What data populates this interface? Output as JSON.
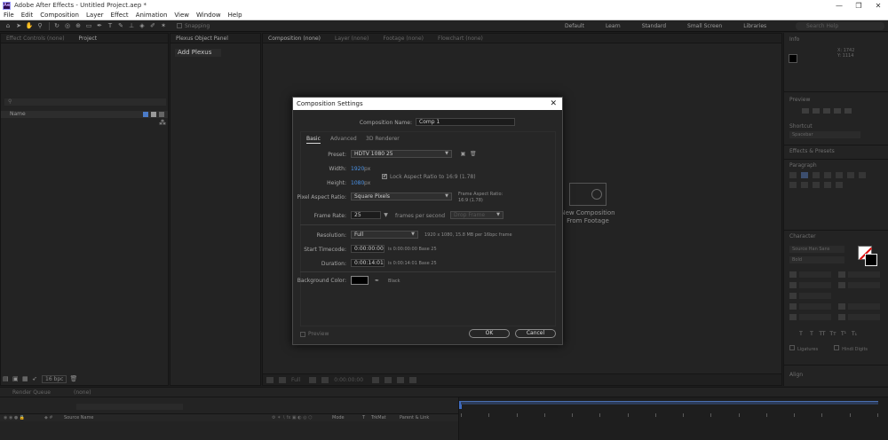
{
  "titlebar": {
    "logo": "Ae",
    "title": "Adobe After Effects - Untitled Project.aep *",
    "minimize": "—",
    "restore": "❐",
    "close": "✕"
  },
  "menu": [
    "File",
    "Edit",
    "Composition",
    "Layer",
    "Effect",
    "Animation",
    "View",
    "Window",
    "Help"
  ],
  "toolbar": {
    "snapping": "Snapping",
    "workspaces": [
      "Default",
      "Learn",
      "Standard",
      "Small Screen",
      "Libraries"
    ],
    "search_placeholder": "Search Help"
  },
  "project_panel": {
    "tabs": [
      "Effect Controls (none)",
      "Project"
    ],
    "column_name": "Name",
    "bpc": "16 bpc"
  },
  "plexus_panel": {
    "tab": "Plexus Object Panel",
    "add_button": "Add Plexus"
  },
  "comp_panel": {
    "tabs": [
      "Composition (none)",
      "Layer (none)",
      "Footage (none)",
      "Flowchart (none)"
    ],
    "placeholder_line1": "New Composition",
    "placeholder_line2": "From Footage",
    "timecode": "0:00:00:00",
    "zoom": "Full"
  },
  "right_panels": {
    "info": "Info",
    "info_xy": [
      "X: 1742",
      "Y: 1114"
    ],
    "preview": "Preview",
    "shortcut_label": "Shortcut",
    "shortcut_value": "Spacebar",
    "effects_presets": "Effects & Presets",
    "paragraph": "Paragraph",
    "character": "Character",
    "font": "Source Han Sans",
    "font_style": "Bold",
    "size": "100 px",
    "ligatures": "Ligatures",
    "hindi_digits": "Hindi Digits",
    "align": "Align"
  },
  "timeline": {
    "tabs": [
      "Render Queue",
      "(none)"
    ],
    "columns": [
      "Source Name",
      "Mode",
      "T",
      "TrkMat",
      "Parent & Link"
    ]
  },
  "dialog": {
    "title": "Composition Settings",
    "close": "✕",
    "comp_name_label": "Composition Name:",
    "comp_name": "Comp 1",
    "tabs": [
      "Basic",
      "Advanced",
      "3D Renderer"
    ],
    "preset_label": "Preset:",
    "preset": "HDTV 1080 25",
    "width_label": "Width:",
    "width": "1920",
    "height_label": "Height:",
    "height": "1080",
    "px": "px",
    "lock_aspect": "Lock Aspect Ratio to 16:9 (1.78)",
    "par_label": "Pixel Aspect Ratio:",
    "par": "Square Pixels",
    "frame_aspect_label": "Frame Aspect Ratio:",
    "frame_aspect_value": "16:9 (1.78)",
    "frame_rate_label": "Frame Rate:",
    "frame_rate": "25",
    "frames_per_second": "frames per second",
    "drop_frame": "Drop Frame",
    "resolution_label": "Resolution:",
    "resolution": "Full",
    "resolution_info": "1920 x 1080, 15.8 MB per 16bpc frame",
    "start_tc_label": "Start Timecode:",
    "start_tc": "0:00:00:00",
    "start_tc_info": "is 0:00:00:00  Base 25",
    "duration_label": "Duration:",
    "duration": "0:00:14:01",
    "duration_info": "is 0:00:14:01  Base 25",
    "bg_color_label": "Background Color:",
    "bg_color_name": "Black",
    "preview": "Preview",
    "ok": "OK",
    "cancel": "Cancel"
  },
  "colors": {
    "accent_blue": "#4a92e6",
    "panel_bg": "#232323",
    "dialog_bg": "#262626"
  }
}
